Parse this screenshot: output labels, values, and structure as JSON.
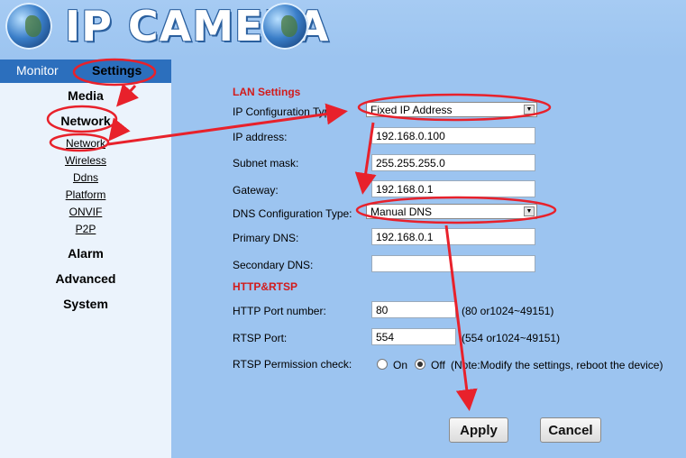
{
  "header": {
    "title": "IP CAMERA"
  },
  "nav": {
    "tabs": [
      "Monitor",
      "Settings"
    ],
    "categories": {
      "media": "Media",
      "network": "Network",
      "alarm": "Alarm",
      "advanced": "Advanced",
      "system": "System"
    },
    "network_sub": [
      "Network",
      "Wireless",
      "Ddns",
      "Platform",
      "ONVIF",
      "P2P"
    ]
  },
  "lan": {
    "heading": "LAN Settings",
    "ip_config_label": "IP Configuration Type:",
    "ip_config_value": "Fixed IP Address",
    "ip_address_label": "IP address:",
    "ip_address_value": "192.168.0.100",
    "subnet_label": "Subnet mask:",
    "subnet_value": "255.255.255.0",
    "gateway_label": "Gateway:",
    "gateway_value": "192.168.0.1",
    "dns_config_label": "DNS Configuration Type:",
    "dns_config_value": "Manual DNS",
    "primary_dns_label": "Primary DNS:",
    "primary_dns_value": "192.168.0.1",
    "secondary_dns_label": "Secondary DNS:",
    "secondary_dns_value": ""
  },
  "http": {
    "heading": "HTTP&RTSP",
    "http_port_label": "HTTP Port number:",
    "http_port_value": "80",
    "http_port_hint": "(80 or1024~49151)",
    "rtsp_port_label": "RTSP Port:",
    "rtsp_port_value": "554",
    "rtsp_port_hint": "(554 or1024~49151)",
    "rtsp_perm_label": "RTSP Permission check:",
    "on_label": "On",
    "off_label": "Off",
    "perm_selected": "Off",
    "note": "(Note:Modify the settings, reboot the device)"
  },
  "actions": {
    "apply": "Apply",
    "cancel": "Cancel"
  },
  "colors": {
    "annotation": "#e8212b",
    "section_heading": "#d21b1b",
    "tab_bar": "#2c6fbd",
    "page_bg": "#9cc4f0"
  }
}
